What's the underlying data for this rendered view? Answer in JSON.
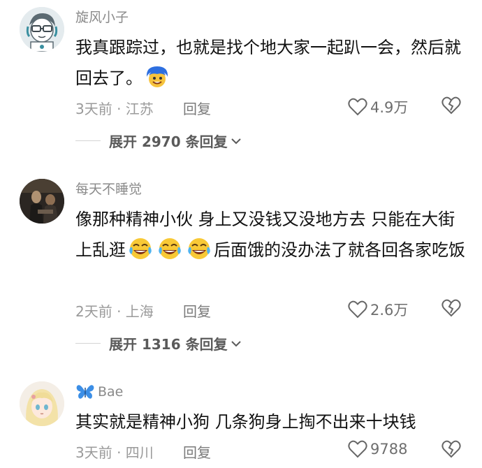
{
  "comments": [
    {
      "username": "旋风小子",
      "content_before": "我真跟踪过，也就是找个地大家一起趴一会，然后就回去了。",
      "time_location": "3天前 · 江苏",
      "reply_label": "回复",
      "likes": "4.9万",
      "expand_label": "展开 2970 条回复",
      "avatar_icon": "cartoon-boy-glasses-avatar",
      "emoji_icon": "blue-hair-smiling-emoji"
    },
    {
      "username": "每天不睡觉",
      "content_before": "像那种精神小伙 身上又没钱又没地方去 只能在大街上乱逛",
      "content_after": "后面饿的没办法了就各回各家吃饭",
      "time_location": "2天前 · 上海",
      "reply_label": "回复",
      "likes": "2.6万",
      "expand_label": "展开 1316 条回复",
      "avatar_icon": "dark-photo-avatar",
      "emoji_icon": "tears-of-joy-emoji"
    },
    {
      "username": "Bae",
      "content_before": "其实就是精神小狗 几条狗身上掏不出来十块钱",
      "time_location": "3天前 · 四川",
      "reply_label": "回复",
      "likes": "9788",
      "avatar_icon": "anime-girl-avatar",
      "username_icon": "blue-butterfly-icon"
    }
  ],
  "colors": {
    "text": "#111111",
    "meta": "#9a9a9a",
    "accent_butterfly": "#3b8ee6"
  }
}
